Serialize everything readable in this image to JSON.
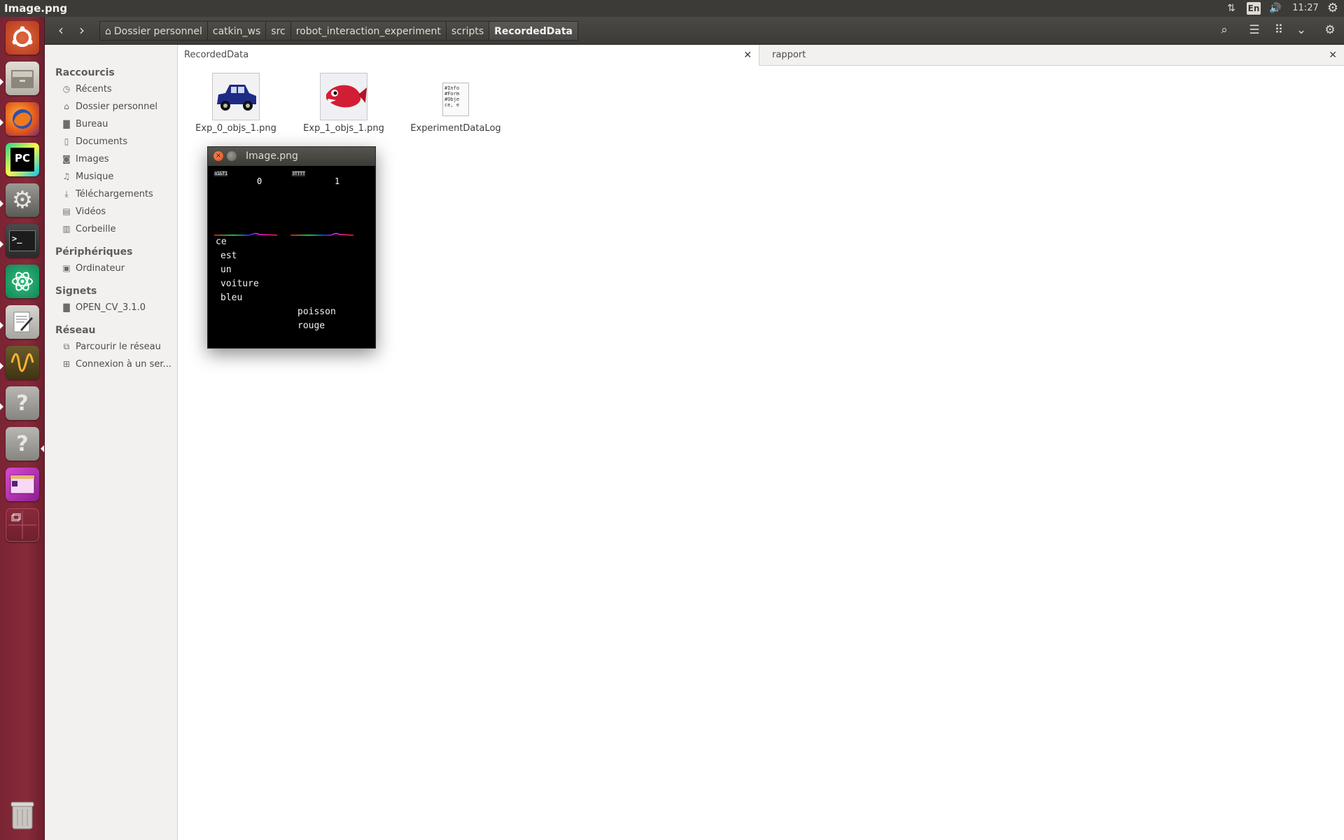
{
  "top_panel": {
    "window_title": "Image.png",
    "keyboard_layout": "En",
    "clock": "11:27"
  },
  "launcher": {
    "items": [
      {
        "name": "ubuntu-dash"
      },
      {
        "name": "files"
      },
      {
        "name": "firefox"
      },
      {
        "name": "pycharm",
        "label": "PC"
      },
      {
        "name": "system-settings"
      },
      {
        "name": "terminal"
      },
      {
        "name": "atom"
      },
      {
        "name": "text-editor"
      },
      {
        "name": "oscilloscope"
      },
      {
        "name": "unknown-app-1",
        "label": "?"
      },
      {
        "name": "unknown-app-2",
        "label": "?"
      },
      {
        "name": "app-window"
      },
      {
        "name": "workspace-switcher"
      },
      {
        "name": "trash"
      }
    ]
  },
  "pathbar": {
    "crumbs": [
      "Dossier personnel",
      "catkin_ws",
      "src",
      "robot_interaction_experiment",
      "scripts",
      "RecordedData"
    ]
  },
  "sidebar": {
    "sections": [
      {
        "title": "Raccourcis",
        "items": [
          "Récents",
          "Dossier personnel",
          "Bureau",
          "Documents",
          "Images",
          "Musique",
          "Téléchargements",
          "Vidéos",
          "Corbeille"
        ]
      },
      {
        "title": "Périphériques",
        "items": [
          "Ordinateur"
        ]
      },
      {
        "title": "Signets",
        "items": [
          "OPEN_CV_3.1.0"
        ]
      },
      {
        "title": "Réseau",
        "items": [
          "Parcourir le réseau",
          "Connexion à un ser..."
        ]
      }
    ]
  },
  "tabs": [
    {
      "label": "RecordedData",
      "active": true
    },
    {
      "label": "rapport",
      "active": false
    }
  ],
  "files": [
    {
      "name": "Exp_0_objs_1.png",
      "thumb": "blue-car"
    },
    {
      "name": "Exp_1_objs_1.png",
      "thumb": "red-fish"
    },
    {
      "name": "ExperimentDataLog",
      "thumb": "text-document",
      "preview": "#Info\n#Form\n#Obje\nce, e"
    }
  ],
  "viewer": {
    "title": "Image.png",
    "canvas": {
      "tiny_labels": [
        "a1&T1",
        "3TTTT"
      ],
      "numbers": [
        "0",
        "1"
      ],
      "left_words": [
        "ce",
        "est",
        "un",
        "voiture",
        "bleu"
      ],
      "right_words": [
        "poisson",
        "rouge"
      ]
    }
  },
  "colors": {
    "top_panel": "#3c3b37",
    "launcher": "#872a3a",
    "sidebar": "#f2f1f0",
    "accent_orange": "#df4a16"
  }
}
